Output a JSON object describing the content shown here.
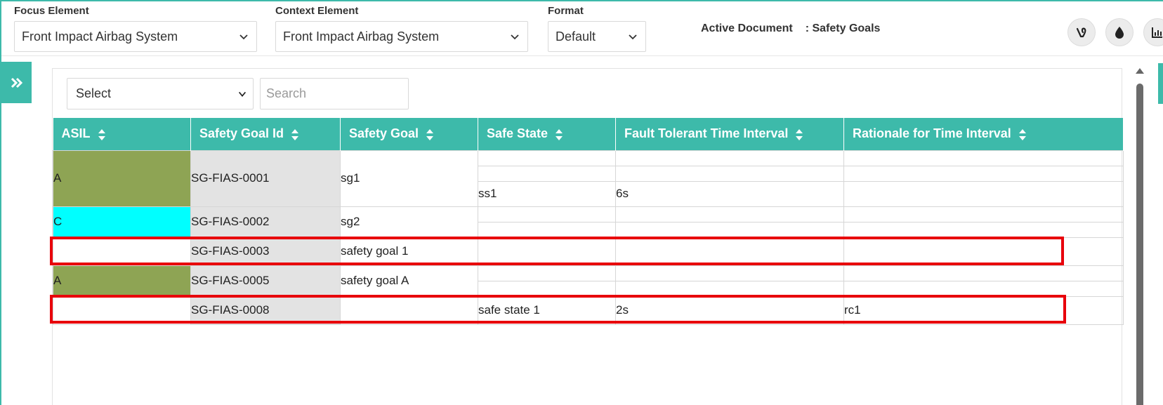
{
  "header": {
    "focus": {
      "label": "Focus Element",
      "value": "Front Impact Airbag System"
    },
    "context": {
      "label": "Context Element",
      "value": "Front Impact Airbag System"
    },
    "format": {
      "label": "Format",
      "value": "Default"
    },
    "active_document": {
      "label": "Active Document",
      "value": ": Safety Goals"
    },
    "icons": [
      "vine-icon",
      "droplet-icon",
      "bar-chart-icon"
    ]
  },
  "filter": {
    "select_value": "Select",
    "search_placeholder": "Search"
  },
  "table": {
    "columns": [
      "ASIL",
      "Safety Goal Id",
      "Safety Goal",
      "Safe State",
      "Fault Tolerant Time Interval",
      "Rationale for Time Interval"
    ],
    "rows": [
      {
        "asil": "A",
        "asil_color": "#8ea454",
        "id": "SG-FIAS-0001",
        "goal": "sg1",
        "sub": [
          {
            "state": "",
            "ftti": "",
            "rationale": ""
          },
          {
            "state": "",
            "ftti": "",
            "rationale": ""
          },
          {
            "state": "ss1",
            "ftti": "6s",
            "rationale": ""
          }
        ]
      },
      {
        "asil": "C",
        "asil_color": "#00ffff",
        "id": "SG-FIAS-0002",
        "goal": "sg2",
        "sub": [
          {
            "state": "",
            "ftti": "",
            "rationale": ""
          },
          {
            "state": "",
            "ftti": "",
            "rationale": ""
          }
        ]
      },
      {
        "asil": "",
        "asil_color": "#ffffff",
        "id": "SG-FIAS-0003",
        "goal": "safety goal 1",
        "sub": [
          {
            "state": "",
            "ftti": "",
            "rationale": ""
          }
        ]
      },
      {
        "asil": "A",
        "asil_color": "#8ea454",
        "id": "SG-FIAS-0005",
        "goal": "safety goal A",
        "sub": [
          {
            "state": "",
            "ftti": "",
            "rationale": ""
          },
          {
            "state": "",
            "ftti": "",
            "rationale": ""
          }
        ]
      },
      {
        "asil": "",
        "asil_color": "#ffffff",
        "id": "SG-FIAS-0008",
        "goal": "",
        "sub": [
          {
            "state": "safe state 1",
            "ftti": "2s",
            "rationale": "rc1"
          }
        ]
      }
    ]
  },
  "highlight_color": "#e8000b",
  "accent_color": "#3dbaaa"
}
